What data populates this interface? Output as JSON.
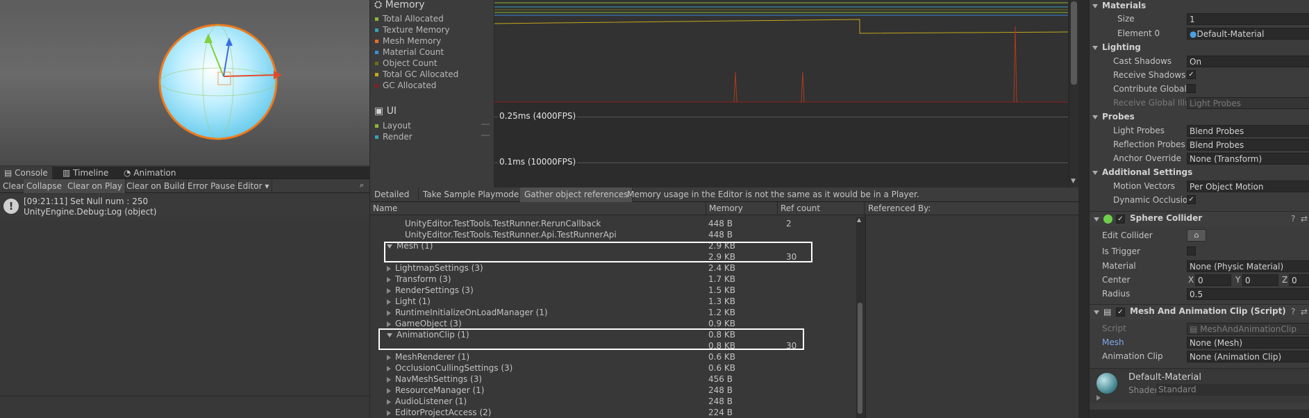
{
  "console": {
    "tabs": [
      "Console",
      "Timeline",
      "Animation"
    ],
    "toolbar": [
      "Clear",
      "Collapse",
      "Clear on Play",
      "Clear on Build",
      "Error Pause",
      "Editor"
    ],
    "log_line1": "[09:21:11] Set Null num :  250",
    "log_line2": "UnityEngine.Debug:Log (object)"
  },
  "profiler": {
    "memory_title": "Memory",
    "memory_legend": [
      {
        "label": "Total Allocated",
        "color": "#8ab934"
      },
      {
        "label": "Texture Memory",
        "color": "#3a9fb7"
      },
      {
        "label": "Mesh Memory",
        "color": "#e0712b"
      },
      {
        "label": "Material Count",
        "color": "#3f8bd9"
      },
      {
        "label": "Object Count",
        "color": "#6e6e1a"
      },
      {
        "label": "Total GC Allocated",
        "color": "#c4a81a"
      },
      {
        "label": "GC Allocated",
        "color": "#8a1e1e"
      }
    ],
    "ui_title": "UI",
    "ui_legend": [
      {
        "label": "Layout",
        "color": "#8ab934"
      },
      {
        "label": "Render",
        "color": "#3a9fb7"
      }
    ],
    "ui_marker1": "0.25ms (4000FPS)",
    "ui_marker2": "0.1ms (10000FPS)"
  },
  "memory_bar": {
    "mode": "Detailed",
    "take_sample": "Take Sample Playmode",
    "gather": "Gather object references",
    "notice": "Memory usage in the Editor is not the same as it would be in a Player."
  },
  "table": {
    "col_name": "Name",
    "col_memory": "Memory",
    "col_ref": "Ref count",
    "col_refby": "Referenced By:",
    "rows": [
      {
        "name": "UnityEditor.TestTools.TestRunner.RerunCallback",
        "memory": "448 B",
        "ref": "2"
      },
      {
        "name": "UnityEditor.TestTools.TestRunner.Api.TestRunnerApi",
        "memory": "448 B",
        "ref": ""
      },
      {
        "name": "Mesh (1)",
        "memory": "2.9 KB",
        "ref": ""
      },
      {
        "name": "",
        "memory": "2.9 KB",
        "ref": "30"
      },
      {
        "name": "LightmapSettings (3)",
        "memory": "2.4 KB",
        "ref": ""
      },
      {
        "name": "Transform (3)",
        "memory": "1.7 KB",
        "ref": ""
      },
      {
        "name": "RenderSettings (3)",
        "memory": "1.5 KB",
        "ref": ""
      },
      {
        "name": "Light (1)",
        "memory": "1.3 KB",
        "ref": ""
      },
      {
        "name": "RuntimeInitializeOnLoadManager (1)",
        "memory": "1.2 KB",
        "ref": ""
      },
      {
        "name": "GameObject (3)",
        "memory": "0.9 KB",
        "ref": ""
      },
      {
        "name": "AnimationClip (1)",
        "memory": "0.8 KB",
        "ref": ""
      },
      {
        "name": "",
        "memory": "0.8 KB",
        "ref": "30"
      },
      {
        "name": "MeshRenderer (1)",
        "memory": "0.6 KB",
        "ref": ""
      },
      {
        "name": "OcclusionCullingSettings (3)",
        "memory": "0.6 KB",
        "ref": ""
      },
      {
        "name": "NavMeshSettings (3)",
        "memory": "456 B",
        "ref": ""
      },
      {
        "name": "ResourceManager (1)",
        "memory": "248 B",
        "ref": ""
      },
      {
        "name": "AudioListener (1)",
        "memory": "248 B",
        "ref": ""
      },
      {
        "name": "EditorProjectAccess (2)",
        "memory": "224 B",
        "ref": ""
      }
    ]
  },
  "inspector": {
    "materials": {
      "title": "Materials",
      "size_label": "Size",
      "size_value": "1",
      "element_label": "Element 0",
      "element_value": "Default-Material"
    },
    "lighting": {
      "title": "Lighting",
      "cast_label": "Cast Shadows",
      "cast_value": "On",
      "receive_label": "Receive Shadows",
      "contribute_label": "Contribute Global I",
      "receive_gi_label": "Receive Global Illu",
      "receive_gi_value": "Light Probes"
    },
    "probes": {
      "title": "Probes",
      "light_label": "Light Probes",
      "light_value": "Blend Probes",
      "refl_label": "Reflection Probes",
      "refl_value": "Blend Probes",
      "anchor_label": "Anchor Override",
      "anchor_value": "None (Transform)"
    },
    "additional": {
      "title": "Additional Settings",
      "motion_label": "Motion Vectors",
      "motion_value": "Per Object Motion",
      "dyn_label": "Dynamic Occlusio"
    },
    "sphere": {
      "title": "Sphere Collider",
      "edit_label": "Edit Collider",
      "trigger_label": "Is Trigger",
      "material_label": "Material",
      "material_value": "None (Physic Material)",
      "center_label": "Center",
      "cx": "X",
      "cx_value": "0",
      "cy": "Y",
      "cy_value": "0",
      "cz": "Z",
      "cz_value": "0",
      "radius_label": "Radius",
      "radius_value": "0.5"
    },
    "script": {
      "title": "Mesh And Animation Clip (Script)",
      "script_label": "Script",
      "script_value": "MeshAndAnimationClip",
      "mesh_label": "Mesh",
      "mesh_value": "None (Mesh)",
      "clip_label": "Animation Clip",
      "clip_value": "None (Animation Clip)"
    },
    "material_preview": {
      "name": "Default-Material",
      "shader_label": "Shader",
      "shader_value": "Standard"
    }
  }
}
